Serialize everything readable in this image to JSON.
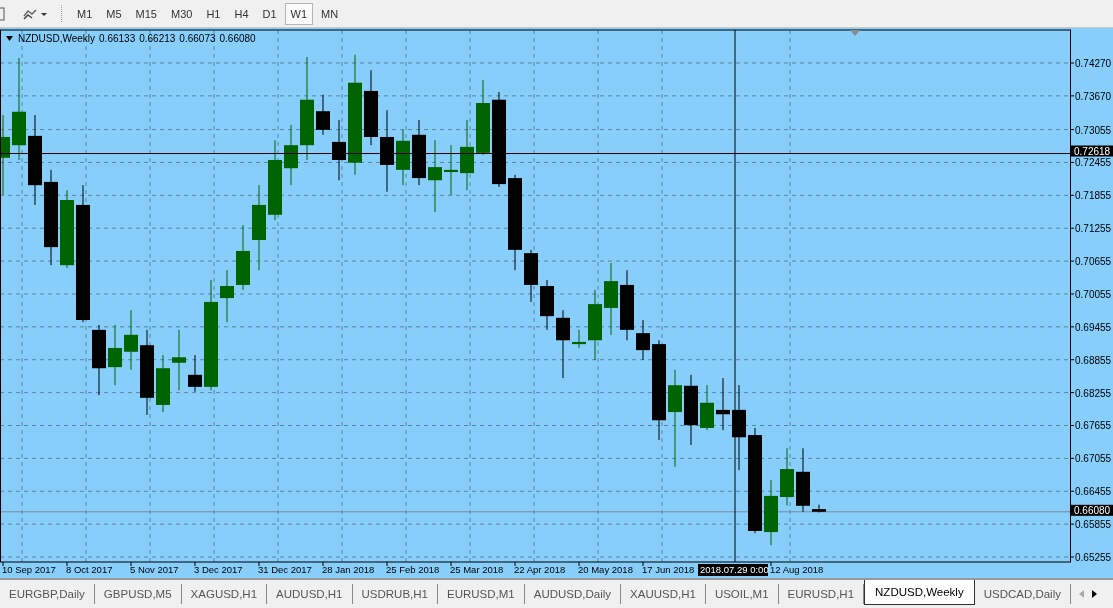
{
  "toolbar": {
    "timeframes": [
      {
        "label": "M1",
        "selected": false
      },
      {
        "label": "M5",
        "selected": false
      },
      {
        "label": "M15",
        "selected": false
      },
      {
        "label": "M30",
        "selected": false
      },
      {
        "label": "H1",
        "selected": false
      },
      {
        "label": "H4",
        "selected": false
      },
      {
        "label": "D1",
        "selected": false
      },
      {
        "label": "W1",
        "selected": true
      },
      {
        "label": "MN",
        "selected": false
      }
    ]
  },
  "chart": {
    "symbol": "NZDUSD,Weekly",
    "ohlc": [
      "0.66133",
      "0.66213",
      "0.66073",
      "0.66080"
    ],
    "current_price": "0.66080",
    "crosshair": {
      "price": "0.72618",
      "time": "2018.07.29 0:00"
    },
    "price_axis": [
      "0.74270",
      "0.73670",
      "0.73055",
      "0.72455",
      "0.71855",
      "0.71255",
      "0.70655",
      "0.70055",
      "0.69455",
      "0.68855",
      "0.68255",
      "0.67655",
      "0.67055",
      "0.66455",
      "0.65855",
      "0.65255"
    ],
    "time_axis": [
      "10 Sep 2017",
      "8 Oct 2017",
      "5 Nov 2017",
      "3 Dec 2017",
      "31 Dec 2017",
      "28 Jan 2018",
      "25 Feb 2018",
      "25 Mar 2018",
      "22 Apr 2018",
      "20 May 2018",
      "17 Jun 2018",
      "12 Aug 2018"
    ]
  },
  "tabs": [
    {
      "label": "EURGBP,Daily",
      "selected": false
    },
    {
      "label": "GBPUSD,M5",
      "selected": false
    },
    {
      "label": "XAGUSD,H1",
      "selected": false
    },
    {
      "label": "AUDUSD,H1",
      "selected": false
    },
    {
      "label": "USDRUB,H1",
      "selected": false
    },
    {
      "label": "EURUSD,M1",
      "selected": false
    },
    {
      "label": "AUDUSD,Daily",
      "selected": false
    },
    {
      "label": "XAUUSD,H1",
      "selected": false
    },
    {
      "label": "USOIL,M1",
      "selected": false
    },
    {
      "label": "EURUSD,H1",
      "selected": false
    },
    {
      "label": "NZDUSD,Weekly",
      "selected": true
    },
    {
      "label": "USDCAD,Daily",
      "selected": false
    }
  ]
}
